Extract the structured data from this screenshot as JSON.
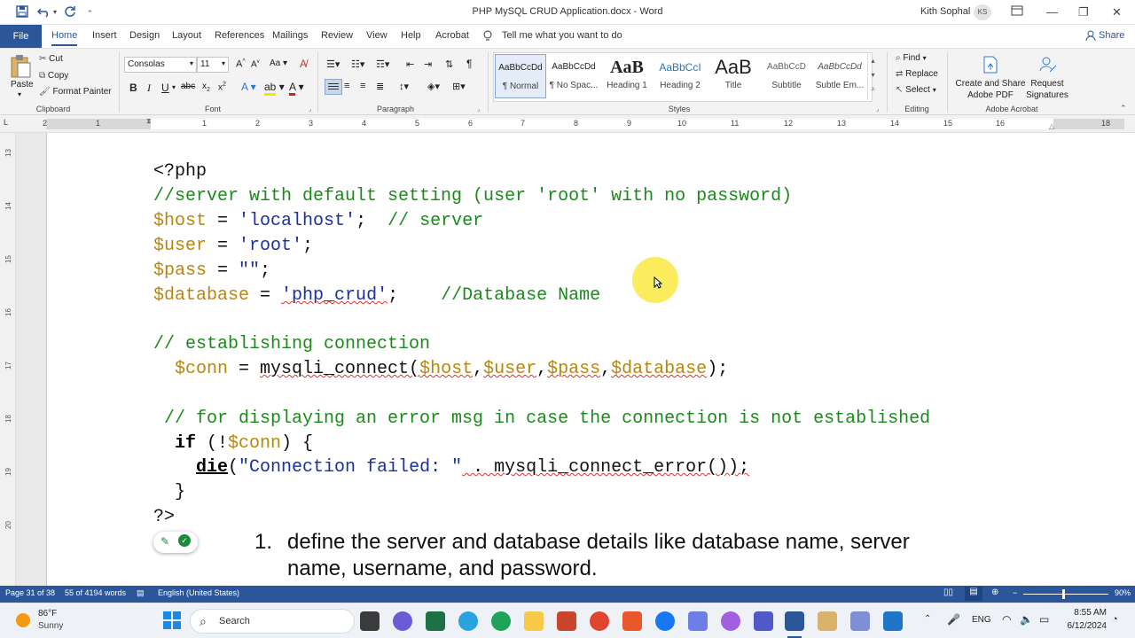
{
  "title": "PHP MySQL CRUD Application.docx  -  Word",
  "user": {
    "name": "Kith Sophal",
    "initials": "KS"
  },
  "tabs": [
    "File",
    "Home",
    "Insert",
    "Design",
    "Layout",
    "References",
    "Mailings",
    "Review",
    "View",
    "Help",
    "Acrobat"
  ],
  "tell_me": "Tell me what you want to do",
  "share": "Share",
  "clipboard": {
    "paste": "Paste",
    "cut": "Cut",
    "copy": "Copy",
    "format_painter": "Format Painter",
    "label": "Clipboard"
  },
  "font": {
    "name": "Consolas",
    "size": "11",
    "label": "Font"
  },
  "paragraph_label": "Paragraph",
  "styles": {
    "label": "Styles",
    "items": [
      {
        "preview": "AaBbCcDd",
        "name": "¶ Normal"
      },
      {
        "preview": "AaBbCcDd",
        "name": "¶ No Spac..."
      },
      {
        "preview": "AaB",
        "name": "Heading 1"
      },
      {
        "preview": "AaBbCcI",
        "name": "Heading 2"
      },
      {
        "preview": "AaB",
        "name": "Title"
      },
      {
        "preview": "AaBbCcD",
        "name": "Subtitle"
      },
      {
        "preview": "AaBbCcDd",
        "name": "Subtle Em..."
      }
    ]
  },
  "editing": {
    "find": "Find",
    "replace": "Replace",
    "select": "Select",
    "label": "Editing"
  },
  "acrobat": {
    "create_share": "Create and Share",
    "adobe_pdf": "Adobe PDF",
    "request": "Request",
    "signatures": "Signatures",
    "label": "Adobe Acrobat"
  },
  "ruler_numbers": [
    "2",
    "1",
    "1",
    "2",
    "3",
    "4",
    "5",
    "6",
    "7",
    "8",
    "9",
    "10",
    "11",
    "12",
    "13",
    "14",
    "15",
    "16",
    "18"
  ],
  "vruler_numbers": [
    "13",
    "14",
    "15",
    "16",
    "17",
    "18",
    "19",
    "20"
  ],
  "code": {
    "l1": "<?php",
    "l2": "//server with default setting (user 'root' with no password)",
    "l3_var": "$host",
    "l3_eq": " = ",
    "l3_str": "'localhost'",
    "l3_semi": ";  ",
    "l3_cm": "// server",
    "l4_var": "$user",
    "l4_eq": " = ",
    "l4_str": "'root'",
    "l4_semi": ";",
    "l5_var": "$pass",
    "l5_eq": " = ",
    "l5_str": "\"\"",
    "l5_semi": ";",
    "l6_var": "$database",
    "l6_eq": " = ",
    "l6_str": "'php_crud'",
    "l6_semi": ";    ",
    "l6_cm": "//Database Name",
    "l7": "// establishing connection",
    "l8_var": "$conn",
    "l8_eq": " = ",
    "l8_fn": "mysqli_connect(",
    "l8_a1": "$host",
    "l8_c1": ",",
    "l8_a2": "$user",
    "l8_c2": ",",
    "l8_a3": "$pass",
    "l8_c3": ",",
    "l8_a4": "$database",
    "l8_end": ");",
    "l9": "// for displaying an error msg in case the connection is not established",
    "l10_kw": "if",
    "l10_a": " (!",
    "l10_var": "$conn",
    "l10_b": ") {",
    "l11_kw": "die",
    "l11_a": "(",
    "l11_str": "\"Connection failed: \"",
    "l11_b": " . mysqli_connect_error());",
    "l12": "}",
    "l13": "?>"
  },
  "list_item": {
    "num": "1.",
    "line1": "define the server and database details like database name, server",
    "line2": "name, username, and password."
  },
  "status": {
    "page": "Page 31 of 38",
    "words": "55 of 4194 words",
    "language": "English (United States)",
    "zoom": "90%"
  },
  "taskbar": {
    "weather_temp": "86°F",
    "weather_desc": "Sunny",
    "search": "Search",
    "lang": "ENG",
    "time": "8:55 AM",
    "date": "6/12/2024"
  }
}
